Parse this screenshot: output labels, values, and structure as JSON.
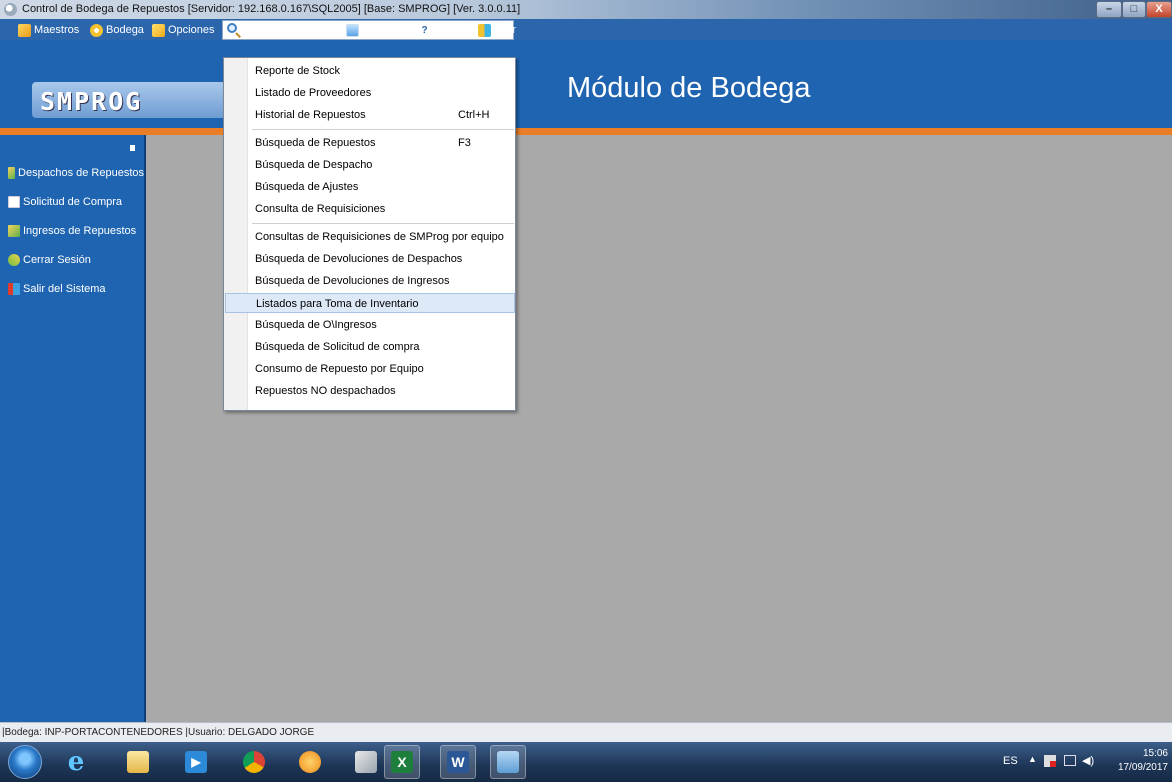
{
  "window": {
    "title": "Control de Bodega de Repuestos  [Servidor: 192.168.0.167\\SQL2005]  [Base: SMPROG]  [Ver. 3.0.0.11]"
  },
  "menubar": {
    "items": [
      "Maestros",
      "Bodega",
      "Opciones",
      "Ventanas",
      "Ayuda",
      "Salir"
    ]
  },
  "header": {
    "logo_text": "SMPROG",
    "module_title": "Módulo de Bodega"
  },
  "sidebar": {
    "items": [
      "Despachos de Repuestos",
      "Solicitud de Compra",
      "Ingresos de Repuestos",
      "Cerrar Sesión",
      "Salir del Sistema"
    ]
  },
  "dropdown": {
    "items": [
      {
        "label": "Reporte de Stock",
        "shortcut": ""
      },
      {
        "label": "Listado de Proveedores",
        "shortcut": ""
      },
      {
        "label": "Historial de Repuestos",
        "shortcut": "Ctrl+H"
      },
      {
        "label": "Búsqueda de Repuestos",
        "shortcut": "F3"
      },
      {
        "label": "Búsqueda de Despacho",
        "shortcut": ""
      },
      {
        "label": "Búsqueda de Ajustes",
        "shortcut": ""
      },
      {
        "label": "Consulta de Requisiciones",
        "shortcut": ""
      },
      {
        "label": "Consultas de Requisiciones de SMProg por equipo",
        "shortcut": ""
      },
      {
        "label": "Búsqueda de Devoluciones de Despachos",
        "shortcut": ""
      },
      {
        "label": "Búsqueda de Devoluciones de Ingresos",
        "shortcut": ""
      },
      {
        "label": "Listados para Toma de Inventario",
        "shortcut": ""
      },
      {
        "label": "Búsqueda de O\\Ingresos",
        "shortcut": ""
      },
      {
        "label": "Búsqueda de Solicitud de compra",
        "shortcut": ""
      },
      {
        "label": "Consumo de Repuesto por Equipo",
        "shortcut": ""
      },
      {
        "label": "Repuestos NO despachados",
        "shortcut": ""
      }
    ]
  },
  "statusbar": {
    "text": "|Bodega:  INP-PORTACONTENEDORES  |Usuario:  DELGADO JORGE"
  },
  "taskbar": {
    "lang": "ES",
    "time": "15:06",
    "date": "17/09/2017"
  },
  "colors": {
    "header_blue": "#1f64b1",
    "accent_orange": "#e97e26",
    "workspace_gray": "#a9a9a9",
    "highlight": "#dde9f7"
  }
}
